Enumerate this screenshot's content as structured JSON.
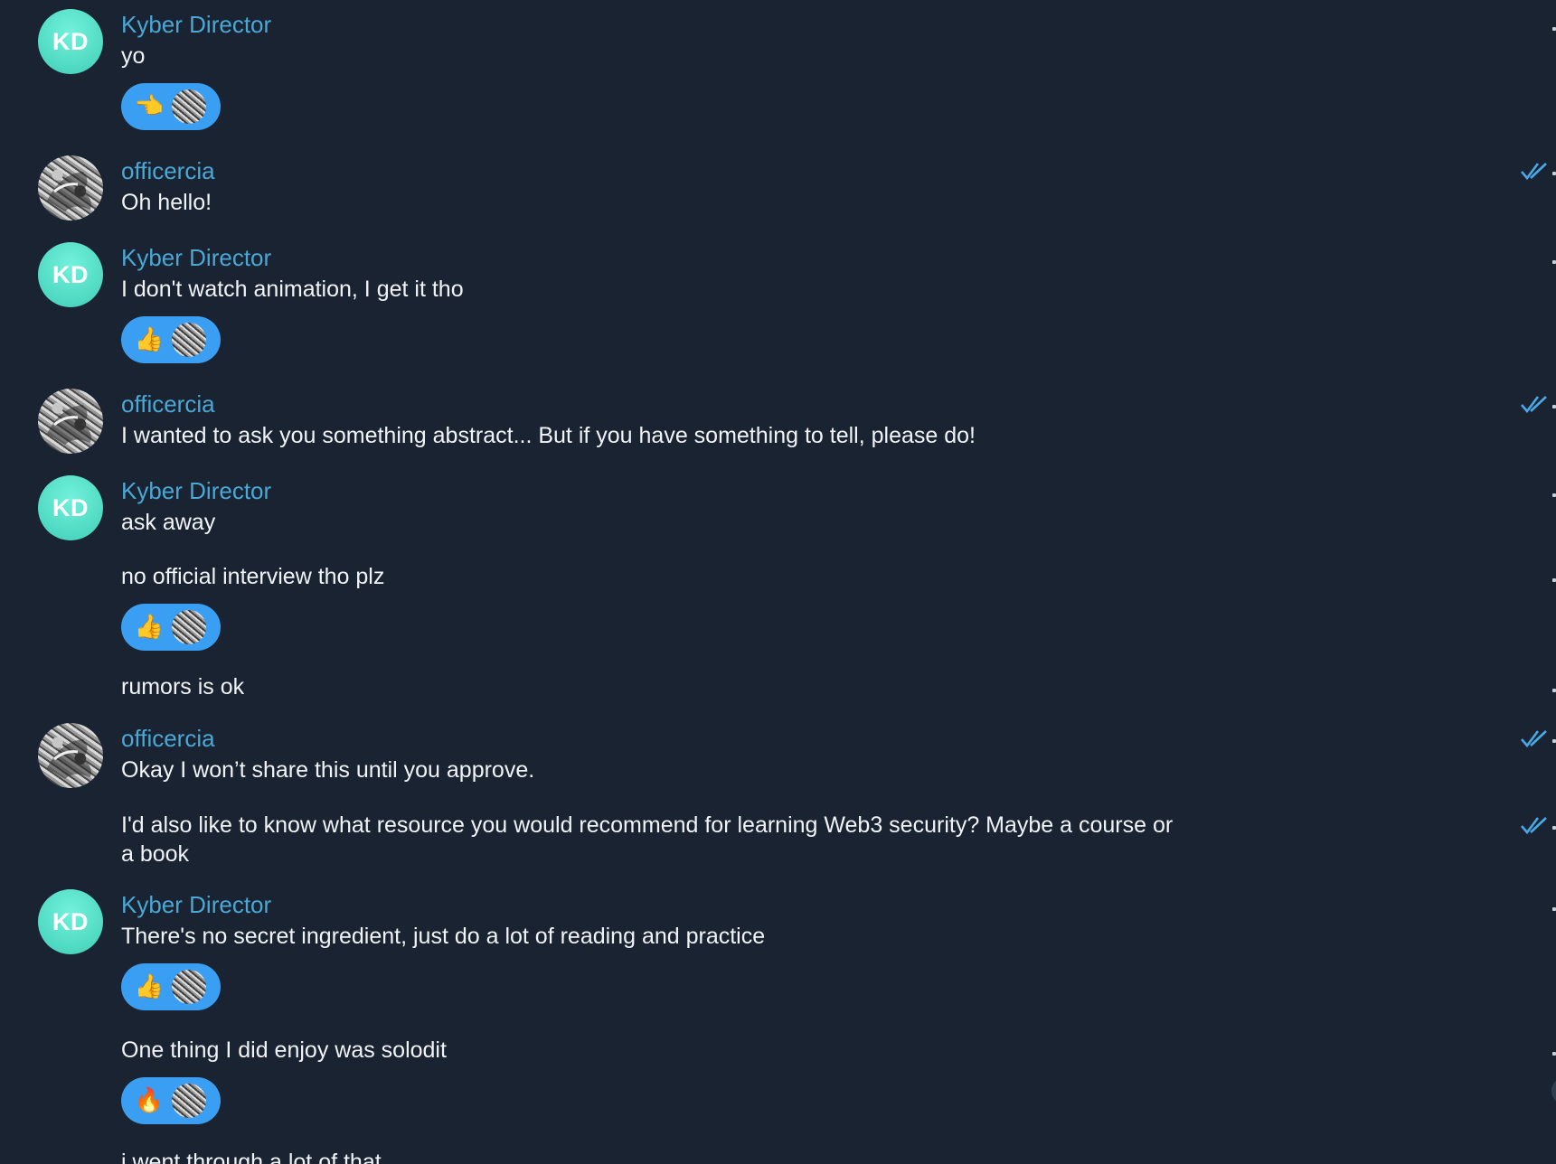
{
  "messages": [
    {
      "sender": "Kyber Director",
      "avatar": "KD",
      "text": "yo",
      "reaction": "👈"
    },
    {
      "sender": "officercia",
      "text": "Oh hello!"
    },
    {
      "sender": "Kyber Director",
      "avatar": "KD",
      "text": "I don't watch animation, I get it tho",
      "reaction": "👍"
    },
    {
      "sender": "officercia",
      "text": "I wanted to ask you something abstract... But if you have something to tell, please do!"
    },
    {
      "sender": "Kyber Director",
      "avatar": "KD",
      "text": "ask away"
    },
    {
      "text": "no official interview tho plz",
      "reaction": "👍"
    },
    {
      "text": "rumors is ok"
    },
    {
      "sender": "officercia",
      "text": "Okay I won’t share this until you approve."
    },
    {
      "text": "I'd also like to know what resource you would recommend for learning Web3 security? Maybe a course or\na book"
    },
    {
      "sender": "Kyber Director",
      "avatar": "KD",
      "text": "There's no secret ingredient, just do a lot of reading and practice",
      "reaction": "👍"
    },
    {
      "text": "One thing I did enjoy was solodit",
      "reaction": "🔥"
    },
    {
      "text": "i went through a lot of that"
    }
  ],
  "icons": {
    "read_receipt": "double-check-icon",
    "reaction_avatar": "officercia-avatar"
  },
  "colors": {
    "background": "#1a2331",
    "sender_name": "#4aa8d6",
    "kd_avatar": "#56dfc8",
    "reaction_pill": "#3a9ff2",
    "read_check": "#4aa8e6"
  }
}
